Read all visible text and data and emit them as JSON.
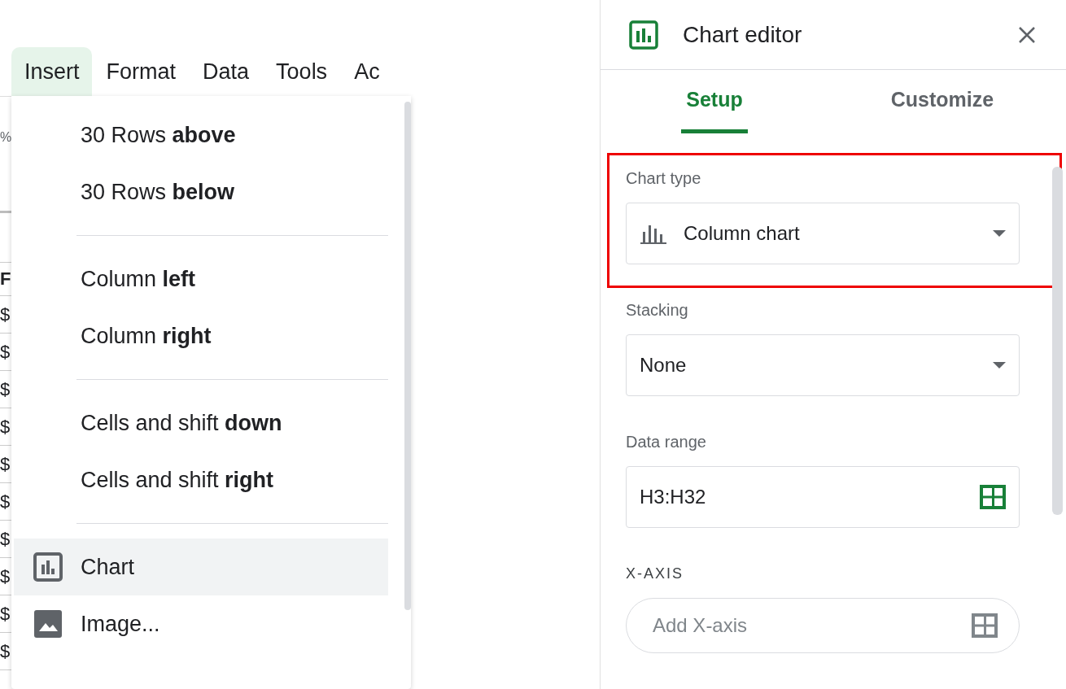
{
  "sheet_fragments": [
    {
      "text": "%",
      "kind": "plain"
    },
    {
      "text": "F",
      "kind": "header"
    },
    {
      "text": "$",
      "kind": "cell"
    },
    {
      "text": "$",
      "kind": "cell"
    },
    {
      "text": "$",
      "kind": "cell"
    },
    {
      "text": "$",
      "kind": "cell"
    },
    {
      "text": "$",
      "kind": "cell"
    },
    {
      "text": "$",
      "kind": "cell"
    },
    {
      "text": "$",
      "kind": "cell"
    },
    {
      "text": "$",
      "kind": "cell"
    },
    {
      "text": "$",
      "kind": "cell"
    },
    {
      "text": "$",
      "kind": "cell"
    }
  ],
  "menu_bar": [
    {
      "label": "Insert",
      "selected": true
    },
    {
      "label": "Format",
      "selected": false
    },
    {
      "label": "Data",
      "selected": false
    },
    {
      "label": "Tools",
      "selected": false
    },
    {
      "label": "Ac",
      "selected": false
    }
  ],
  "insert_menu": {
    "groups": [
      [
        {
          "label": "30 Rows **above**",
          "kind": "plain",
          "highlighted": false
        },
        {
          "label": "30 Rows **below**",
          "kind": "plain",
          "highlighted": false
        }
      ],
      [
        {
          "label": "Column **left**",
          "kind": "plain",
          "highlighted": false
        },
        {
          "label": "Column **right**",
          "kind": "plain",
          "highlighted": false
        }
      ],
      [
        {
          "label": "Cells and shift **down**",
          "kind": "plain",
          "highlighted": false
        },
        {
          "label": "Cells and shift **right**",
          "kind": "plain",
          "highlighted": false
        }
      ],
      [
        {
          "label": "Chart",
          "kind": "chart",
          "highlighted": true
        },
        {
          "label": "Image...",
          "kind": "image",
          "highlighted": false
        }
      ]
    ]
  },
  "chart_editor": {
    "title": "Chart editor",
    "tabs": [
      {
        "label": "Setup",
        "selected": true
      },
      {
        "label": "Customize",
        "selected": false
      }
    ],
    "fields": [
      {
        "kind": "chart-dropdown",
        "label": "Chart type",
        "value": "Column chart",
        "highlighted": true
      },
      {
        "kind": "dropdown",
        "label": "Stacking",
        "value": "None",
        "highlighted": false
      },
      {
        "kind": "range",
        "label": "Data range",
        "value": "H3:H32",
        "highlighted": false
      },
      {
        "kind": "pill",
        "label": "X-AXIS",
        "placeholder": "Add X-axis",
        "highlighted": false
      }
    ]
  }
}
